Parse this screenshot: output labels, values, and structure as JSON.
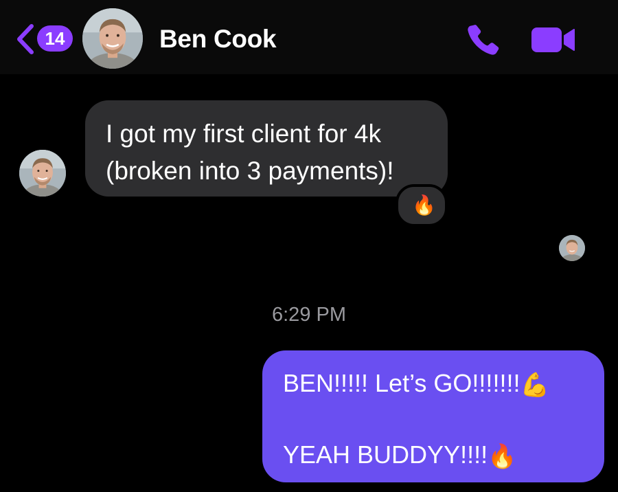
{
  "header": {
    "unread_count": "14",
    "contact_name": "Ben Cook",
    "icons": {
      "back": "chevron-left-icon",
      "call": "phone-icon",
      "video": "video-camera-icon"
    },
    "accent_color": "#8b3dff"
  },
  "messages": [
    {
      "direction": "incoming",
      "lines": [
        "I got my first client for 4k",
        "(broken into 3 payments)!"
      ],
      "reaction": "🔥"
    },
    {
      "direction": "outgoing",
      "lines": [
        "BEN!!!!! Let’s GO!!!!!!!",
        "YEAH BUDDYY!!!!"
      ],
      "emojis": [
        "💪",
        "🔥"
      ],
      "bubble_color": "#6a4ff1"
    }
  ],
  "timestamp": "6:29 PM"
}
